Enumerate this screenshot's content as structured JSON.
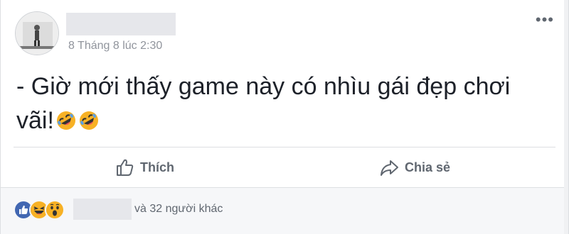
{
  "post": {
    "timestamp": "8 Tháng 8 lúc 2:30",
    "text": "- Giờ mới thấy game này có nhìu gái đẹp chơi vãi!",
    "emojis": [
      "rolling-on-floor-laughing",
      "rolling-on-floor-laughing"
    ],
    "more_label": "•••"
  },
  "actions": {
    "like_label": "Thích",
    "share_label": "Chia sẻ"
  },
  "reactions": {
    "icons": [
      "like",
      "haha",
      "wow"
    ],
    "summary": "và 32 người khác"
  },
  "colors": {
    "like_blue": "#4267b2",
    "reaction_yellow": "#f7b125",
    "text_muted": "#90949c",
    "action_gray": "#606770"
  }
}
